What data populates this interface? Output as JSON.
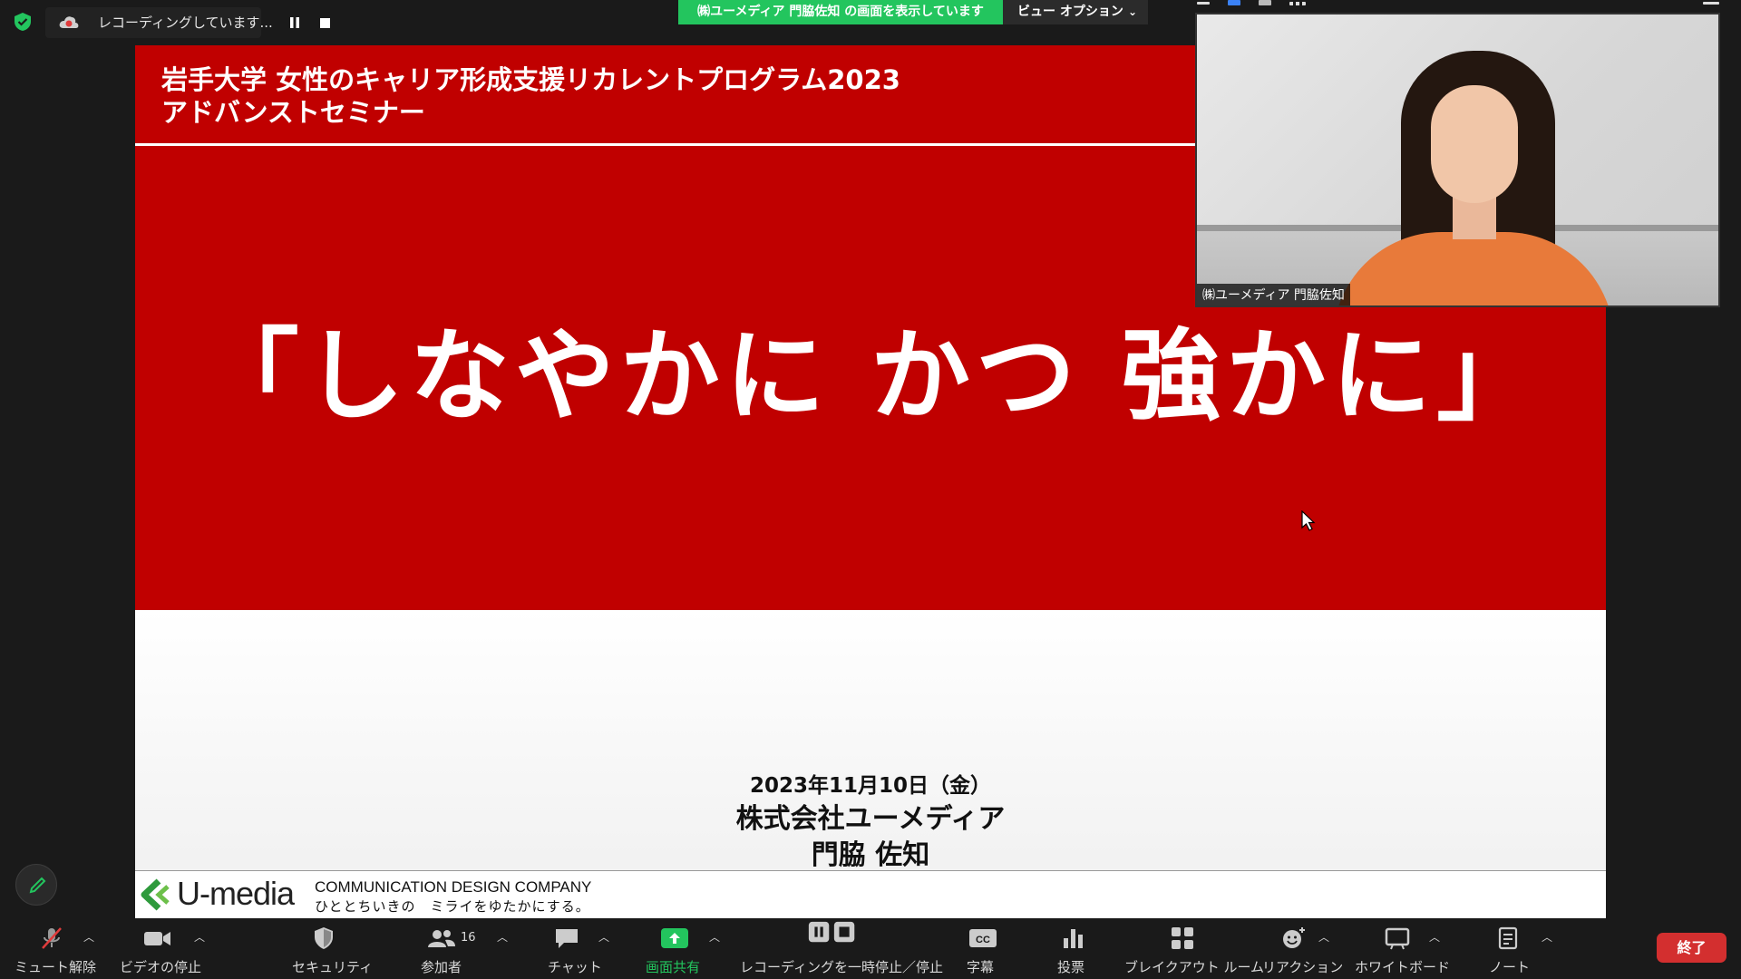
{
  "recording": {
    "status": "レコーディングしています..."
  },
  "share_banner": {
    "text": "㈱ユーメディア 門脇佐知 の画面を表示しています",
    "view_options": "ビュー オプション"
  },
  "slide": {
    "header_line1": "岩手大学 女性のキャリア形成支援リカレントプログラム2023",
    "header_line2": "アドバンストセミナー",
    "title": "「しなやかに かつ 強かに」",
    "date": "2023年11月10日（金）",
    "company": "株式会社ユーメディア",
    "presenter": "門脇 佐知",
    "logo": "U-media",
    "footer_company": "COMMUNICATION DESIGN COMPANY",
    "footer_tagline": "ひととちいきの　ミライをゆたかにする。"
  },
  "video": {
    "name": "㈱ユーメディア 門脇佐知"
  },
  "toolbar": {
    "mute": "ミュート解除",
    "video": "ビデオの停止",
    "security": "セキュリティ",
    "participants": "参加者",
    "participants_count": "16",
    "chat": "チャット",
    "share": "画面共有",
    "record": "レコーディングを一時停止／停止",
    "captions": "字幕",
    "polls": "投票",
    "breakout": "ブレイクアウト ルーム",
    "reactions": "リアクション",
    "whiteboard": "ホワイトボード",
    "notes": "ノート",
    "end": "終了"
  },
  "colors": {
    "slide_red": "#c00000",
    "share_green": "#23c55e",
    "end_red": "#d32f2f"
  }
}
